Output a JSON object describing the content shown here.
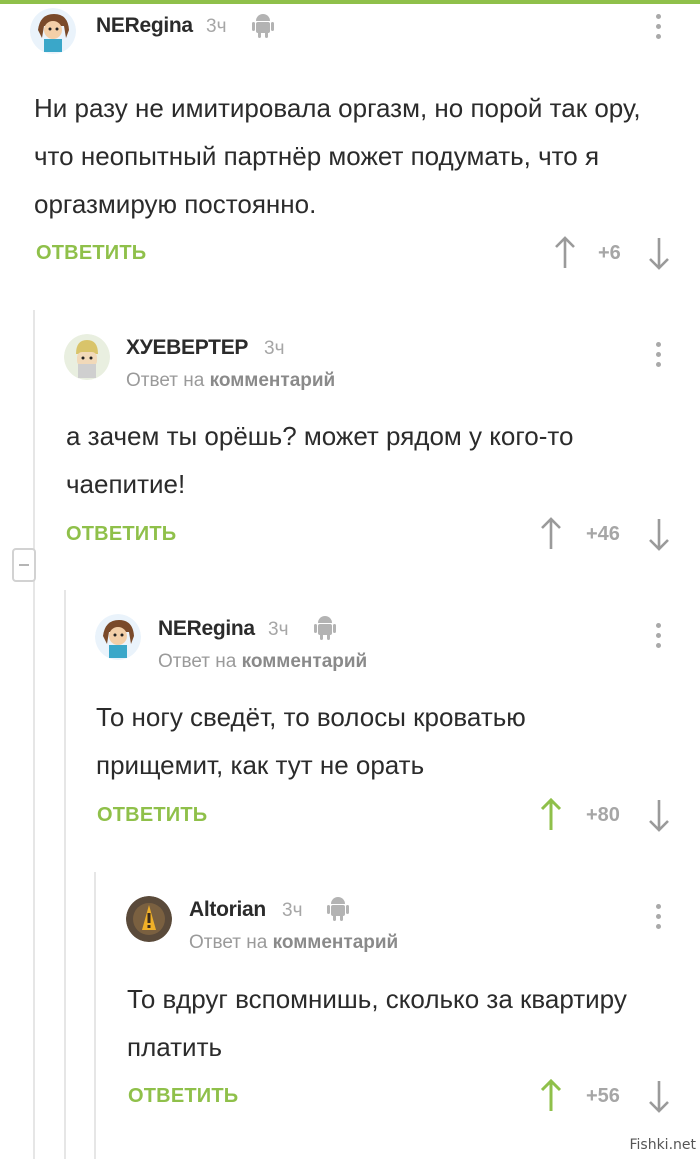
{
  "comments": [
    {
      "author": "NERegina",
      "time": "3ч",
      "reply_to_prefix": "",
      "reply_to_link": "",
      "text": "Ни разу не имитировала оргазм, но порой так ору, что неопытный партнёр может подумать, что я оргазмирую постоянно.",
      "reply_label": "ОТВЕТИТЬ",
      "score": "+6",
      "avatar_icon": "girl-avatar-icon",
      "upvoted": false
    },
    {
      "author": "ХУЕВЕРТЕР",
      "time": "3ч",
      "reply_to_prefix": "Ответ на",
      "reply_to_link": "комментарий",
      "text": "а зачем ты орёшь? может рядом у кого-то чаепитие!",
      "reply_label": "ОТВЕТИТЬ",
      "score": "+46",
      "avatar_icon": "cartoon-avatar-icon",
      "upvoted": false
    },
    {
      "author": "NERegina",
      "time": "3ч",
      "reply_to_prefix": "Ответ на",
      "reply_to_link": "комментарий",
      "text": "То ногу сведёт, то волосы кроватью прищемит, как тут не орать",
      "reply_label": "ОТВЕТИТЬ",
      "score": "+80",
      "avatar_icon": "girl-avatar-icon",
      "upvoted": true
    },
    {
      "author": "Altorian",
      "time": "3ч",
      "reply_to_prefix": "Ответ на",
      "reply_to_link": "комментарий",
      "text": "То вдруг вспомнишь, сколько за квартиру платить",
      "reply_label": "ОТВЕТИТЬ",
      "score": "+56",
      "avatar_icon": "warning-avatar-icon",
      "upvoted": true
    }
  ],
  "watermark": "Fishki.net",
  "colors": {
    "accent": "#8fc04a",
    "muted": "#a6a6a6",
    "text": "#2b2b2b"
  }
}
